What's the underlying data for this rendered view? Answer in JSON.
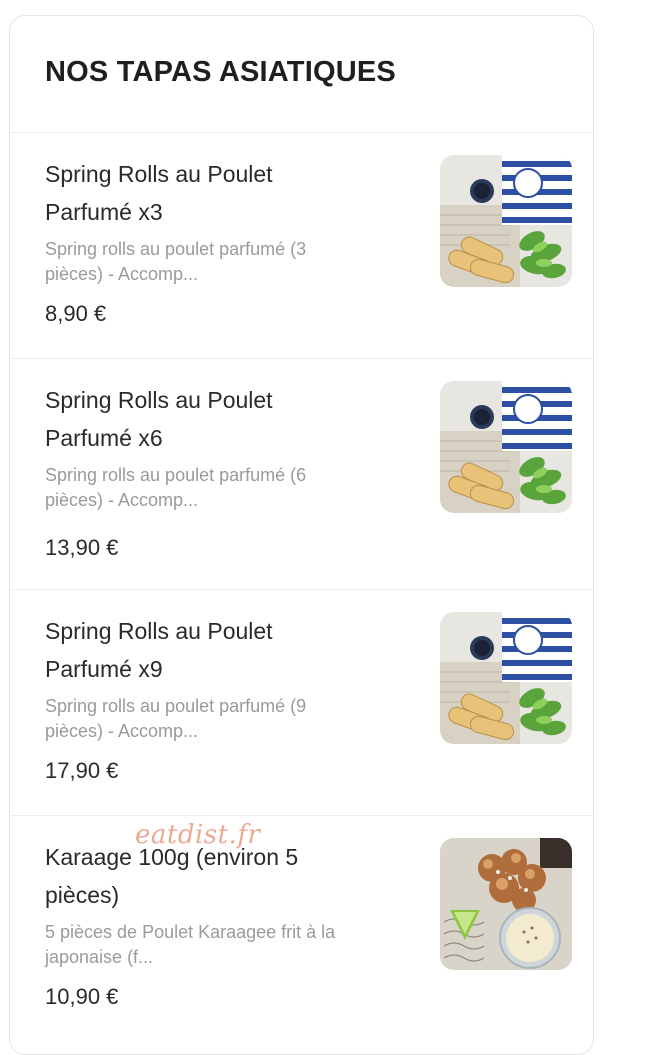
{
  "section": {
    "title": "NOS TAPAS ASIATIQUES"
  },
  "items": [
    {
      "name_line1": "Spring Rolls au Poulet",
      "name_line2": "Parfumé x3",
      "desc_line1": "Spring rolls au poulet parfumé (3",
      "desc_line2": "pièces) - Accomp...",
      "price": "8,90 €",
      "image": "spring-rolls-photo"
    },
    {
      "name_line1": "Spring Rolls au Poulet",
      "name_line2": "Parfumé x6",
      "desc_line1": "Spring rolls au poulet parfumé (6",
      "desc_line2": "pièces) - Accomp...",
      "price": "13,90 €",
      "image": "spring-rolls-photo"
    },
    {
      "name_line1": "Spring Rolls au Poulet",
      "name_line2": "Parfumé x9",
      "desc_line1": "Spring rolls au poulet parfumé (9",
      "desc_line2": "pièces) - Accomp...",
      "price": "17,90 €",
      "image": "spring-rolls-photo"
    },
    {
      "name_line1": "Karaage 100g (environ 5",
      "name_line2": "pièces)",
      "desc_line1": "5 pièces de Poulet Karaagee frit à la",
      "desc_line2": "japonaise (f...",
      "price": "10,90 €",
      "image": "karaage-photo"
    }
  ],
  "watermark": "eatdist.fr",
  "colors": {
    "text": "#2a2a2a",
    "muted": "#9a9a9a",
    "divider": "#ececec",
    "watermark": "#e68c6e"
  }
}
